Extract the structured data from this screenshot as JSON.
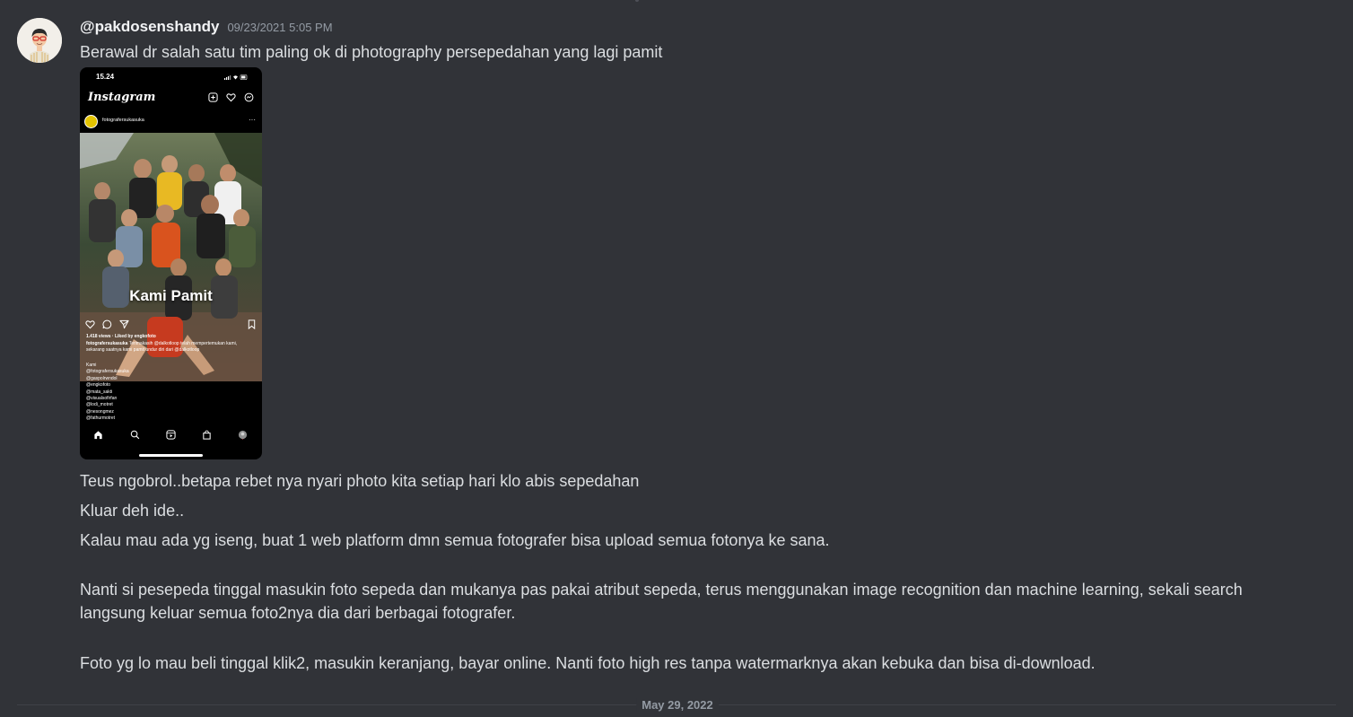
{
  "message": {
    "username": "@pakdosenshandy",
    "timestamp": "09/23/2021 5:05 PM",
    "lines": {
      "l1": "Berawal dr salah satu tim paling ok di photography persepedahan yang lagi pamit",
      "l2": "Teus ngobrol..betapa rebet nya nyari photo kita setiap hari klo abis sepedahan",
      "l3": "Kluar deh ide..",
      "l4": "Kalau mau ada yg iseng, buat 1 web platform dmn semua fotografer bisa upload semua fotonya ke sana.",
      "p5": "Nanti si pesepeda tinggal masukin foto sepeda dan mukanya pas pakai atribut sepeda, terus menggunakan image recognition dan machine learning, sekali search langsung keluar semua foto2nya dia dari berbagai fotografer.",
      "p6": "Foto yg lo mau beli tinggal klik2, masukin keranjang, bayar online. Nanti foto high res tanpa watermarknya akan kebuka dan bisa di-download."
    }
  },
  "attachment": {
    "status_time": "15.24",
    "app_name": "Instagram",
    "post_user": "fotografersukasuka",
    "more": "···",
    "photo_caption": "Kami Pamit",
    "views": "1.418 views · Liked by engkofoto",
    "caption_user": "fotografersukasuka",
    "caption_text": " Terimakasih @dalkotloop telah mempertemukan kami, sekarang saatnya kami pamit undur diri dari @dalkotloop",
    "mentions": [
      "Kami",
      "@fotografersukasuka",
      "@gaspolrwndol",
      "@engkofoto",
      "@mata_sakti",
      "@visualsofirfan",
      "@lodi_motret",
      "@nesongmez",
      "@fathurmotret"
    ]
  },
  "date_divider": "May 29, 2022",
  "colors": {
    "background": "#313338",
    "text": "#dbdee1",
    "muted": "#949ba4"
  }
}
